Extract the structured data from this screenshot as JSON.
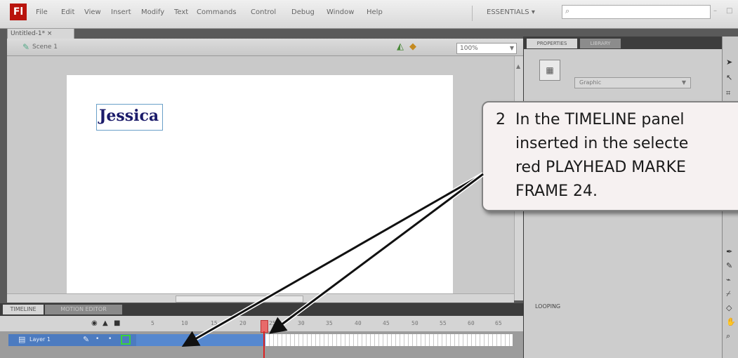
{
  "menubar": {
    "items": [
      "File",
      "Edit",
      "View",
      "Insert",
      "Modify",
      "Text",
      "Commands",
      "Control",
      "Debug",
      "Window",
      "Help"
    ],
    "workspace": "ESSENTIALS",
    "workspace_arrow": "▾",
    "search_icon": "⌕",
    "min_glyph": "–",
    "max_glyph": "□"
  },
  "document": {
    "tab": "Untitled-1* ×",
    "scene": "Scene 1",
    "zoom": "100%"
  },
  "stage": {
    "text": "Jessica"
  },
  "timeline": {
    "tab_timeline": "TIMELINE",
    "tab_motion": "MOTION EDITOR",
    "frame_numbers": [
      "5",
      "10",
      "15",
      "20",
      "25",
      "30",
      "35",
      "40",
      "45",
      "50",
      "55",
      "60",
      "65"
    ],
    "layer_name": "Layer 1",
    "playhead_frame": 24
  },
  "properties": {
    "tab_properties": "PROPERTIES",
    "tab_library": "LIBRARY",
    "instance_type": "Graphic",
    "looping": "LOOPING"
  },
  "callout": {
    "number": "2",
    "line1": "In the TIMELINE panel",
    "line2": "inserted in the selecte",
    "line3": "red PLAYHEAD MARKE",
    "line4": "FRAME 24."
  },
  "icons": {
    "app_logo": "Fl",
    "scene_icon": "film-clapper-icon",
    "edit_scene": "edit-scene-icon",
    "edit_symbol": "edit-symbol-icon"
  },
  "colors": {
    "layer_selected": "#4c7bc0",
    "playhead": "#d22222",
    "callout_bg": "#f6f1f1"
  }
}
